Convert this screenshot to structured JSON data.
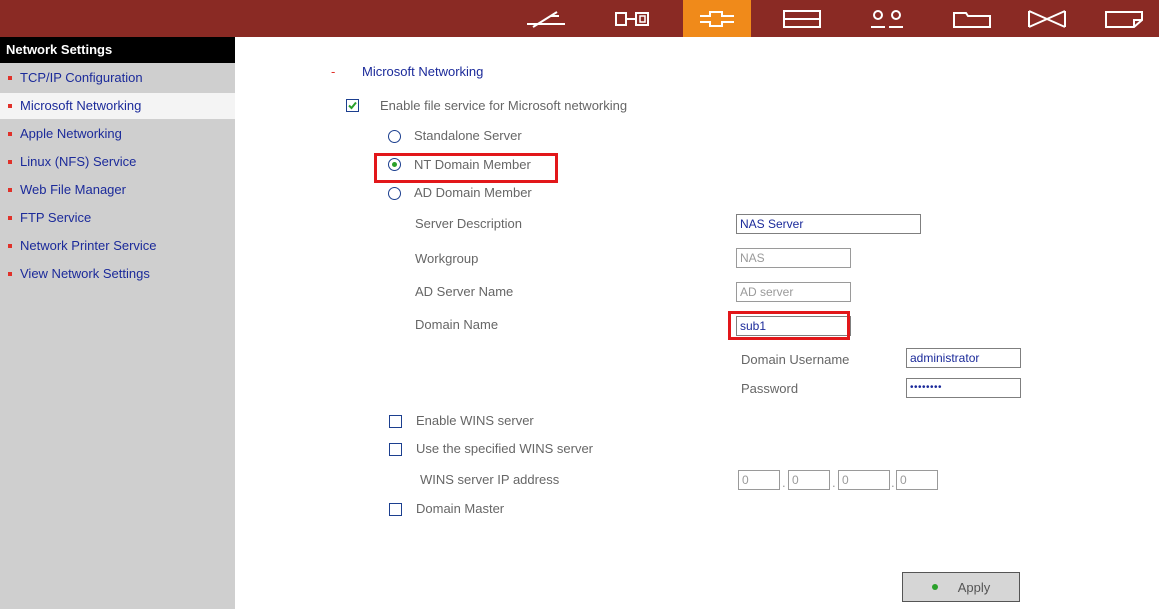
{
  "sidebar": {
    "header": "Network Settings",
    "items": [
      {
        "label": "TCP/IP Configuration"
      },
      {
        "label": "Microsoft Networking"
      },
      {
        "label": "Apple Networking"
      },
      {
        "label": "Linux (NFS) Service"
      },
      {
        "label": "Web File Manager"
      },
      {
        "label": "FTP Service"
      },
      {
        "label": "Network Printer Service"
      },
      {
        "label": "View Network Settings"
      }
    ],
    "selected_index": 1
  },
  "toolbar": {
    "icons": [
      "plane-icon",
      "server-icon",
      "network-icon",
      "disk-icon",
      "users-icon",
      "folder-icon",
      "mail-icon",
      "note-icon"
    ],
    "active_icon": "network-icon"
  },
  "main": {
    "section_marker": "-",
    "section_title": "Microsoft Networking",
    "enable_label": "Enable file service for Microsoft networking",
    "enable_checked": true,
    "modes": [
      {
        "label": "Standalone Server",
        "selected": false
      },
      {
        "label": "NT Domain Member",
        "selected": true
      },
      {
        "label": "AD Domain Member",
        "selected": false
      }
    ],
    "fields": {
      "server_description": {
        "label": "Server Description",
        "value": "NAS Server"
      },
      "workgroup": {
        "label": "Workgroup",
        "value": "NAS"
      },
      "ad_server_name": {
        "label": "AD Server Name",
        "value": "AD server"
      },
      "domain_name": {
        "label": "Domain Name",
        "value": "sub1"
      },
      "domain_username": {
        "label": "Domain Username",
        "value": "administrator"
      },
      "password": {
        "label": "Password",
        "value": "••••••••"
      }
    },
    "enable_wins_label": "Enable WINS server",
    "use_wins_label": "Use the specified WINS server",
    "wins_ip_label": "WINS server IP address",
    "wins_ip": [
      "0",
      "0",
      "0",
      "0"
    ],
    "domain_master_label": "Domain Master",
    "apply_label": "Apply"
  },
  "colors": {
    "topbar": "#8a2a24",
    "active_tab": "#f08a1a",
    "sidebar": "#cfcfcf",
    "link": "#1b2a9a",
    "highlight": "#e2171a"
  }
}
